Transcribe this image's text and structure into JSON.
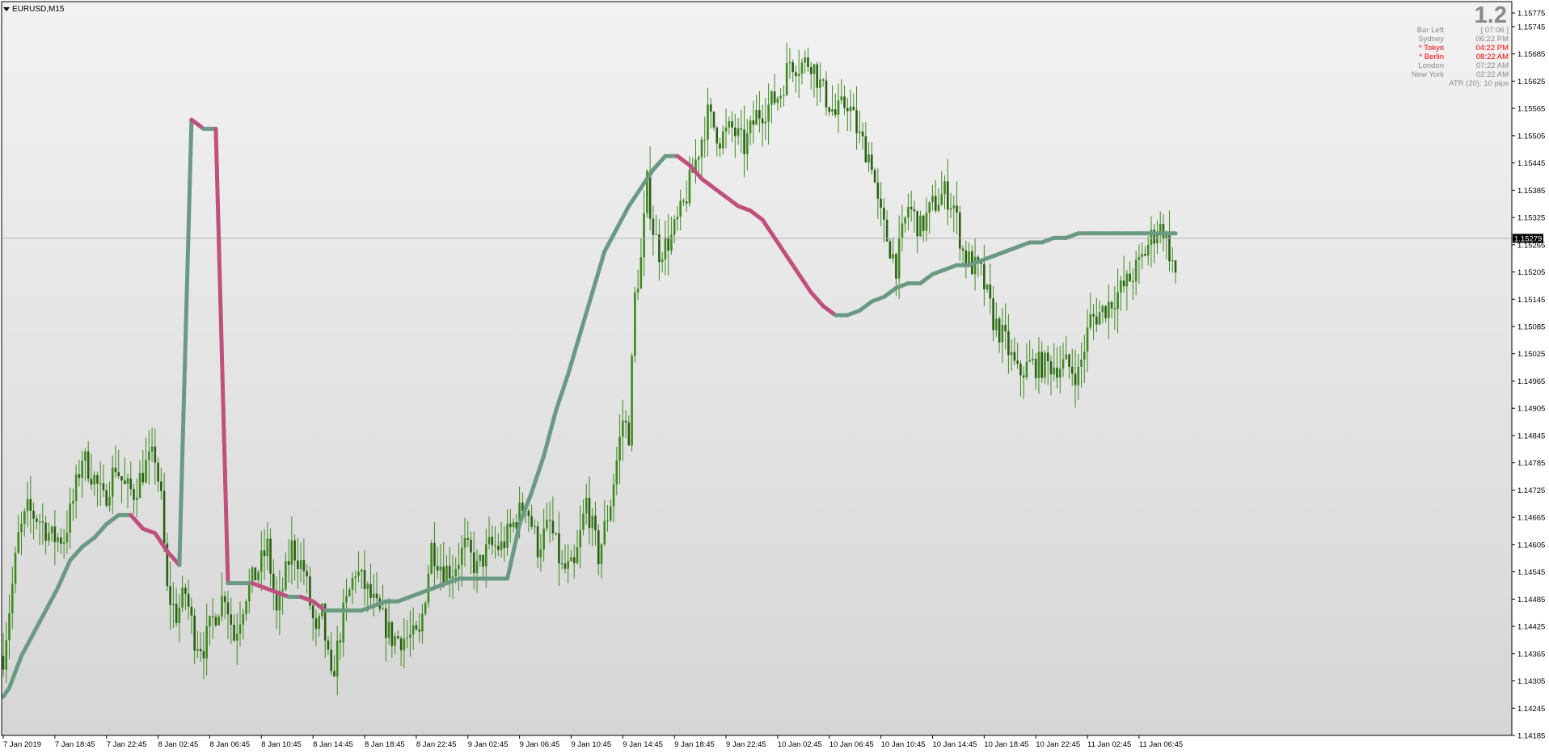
{
  "window": {
    "title": "EURUSD,M15",
    "current_price": "1.15279"
  },
  "info_panel": {
    "spread": "1.2",
    "rows": [
      {
        "label": "Bar Left",
        "value": "[ 07:06 ]",
        "active": false
      },
      {
        "label": "Sydney",
        "value": "06:22 PM",
        "active": false
      },
      {
        "label": "* Tokyo",
        "value": "04:22 PM",
        "active": true
      },
      {
        "label": "* Berlin",
        "value": "08:22 AM",
        "active": true
      },
      {
        "label": "London",
        "value": "07:22 AM",
        "active": false
      },
      {
        "label": "New York",
        "value": "02:22 AM",
        "active": false
      }
    ],
    "atr": "ATR (20): 10 pips"
  },
  "colors": {
    "background_top": "#f2f2f2",
    "background_bottom": "#d6d6d6",
    "candle": "#3d8a1e",
    "ma_up": "#6b9a82",
    "ma_down": "#c0507f",
    "price_line": "#b4b4b4"
  },
  "chart_data": {
    "type": "candlestick",
    "symbol": "EURUSD",
    "timeframe": "M15",
    "ylim": [
      1.14185,
      1.158
    ],
    "y_ticks": [
      "1.15775",
      "1.15745",
      "1.15685",
      "1.15625",
      "1.15565",
      "1.15505",
      "1.15445",
      "1.15385",
      "1.15325",
      "1.15265",
      "1.15205",
      "1.15145",
      "1.15085",
      "1.15025",
      "1.14965",
      "1.14905",
      "1.14845",
      "1.14785",
      "1.14725",
      "1.14665",
      "1.14605",
      "1.14545",
      "1.14485",
      "1.14425",
      "1.14365",
      "1.14305",
      "1.14245",
      "1.14185"
    ],
    "x_ticks": [
      "7 Jan 2019",
      "7 Jan 18:45",
      "7 Jan 22:45",
      "8 Jan 02:45",
      "8 Jan 06:45",
      "8 Jan 10:45",
      "8 Jan 14:45",
      "8 Jan 18:45",
      "8 Jan 22:45",
      "9 Jan 02:45",
      "9 Jan 06:45",
      "9 Jan 10:45",
      "9 Jan 14:45",
      "9 Jan 18:45",
      "9 Jan 22:45",
      "10 Jan 02:45",
      "10 Jan 06:45",
      "10 Jan 10:45",
      "10 Jan 14:45",
      "10 Jan 18:45",
      "10 Jan 22:45",
      "11 Jan 02:45",
      "11 Jan 06:45"
    ],
    "x_tick_bar_index": [
      0,
      17,
      34,
      51,
      68,
      85,
      102,
      119,
      136,
      153,
      170,
      187,
      204,
      221,
      238,
      255,
      272,
      289,
      306,
      323,
      340,
      357,
      374
    ],
    "current_price": 1.15279,
    "close_path_bars": [
      0,
      5,
      8,
      12,
      16,
      20,
      23,
      26,
      30,
      33,
      37,
      40,
      43,
      47,
      50,
      52,
      54,
      57,
      60,
      63,
      66,
      69,
      73,
      76,
      80,
      84,
      87,
      90,
      95,
      99,
      103,
      105,
      108,
      112,
      116,
      120,
      124,
      128,
      133,
      137,
      141,
      145,
      148,
      152,
      156,
      160,
      164,
      168,
      172,
      176,
      180,
      184,
      188,
      192,
      196,
      200,
      204,
      206,
      208,
      210,
      212,
      214,
      216,
      220,
      224,
      228,
      232,
      236,
      240,
      244,
      248,
      252,
      256,
      259,
      262,
      266,
      270,
      274,
      278,
      282,
      286,
      288,
      290,
      294,
      298,
      302,
      306,
      310,
      313,
      316,
      319,
      322,
      326,
      330,
      334,
      338,
      342,
      346,
      350,
      354,
      358,
      362,
      366,
      370,
      374,
      378,
      380,
      382,
      384,
      386
    ],
    "close_path_values": [
      1.1436,
      1.1462,
      1.1468,
      1.1466,
      1.1462,
      1.1462,
      1.147,
      1.148,
      1.1475,
      1.147,
      1.1478,
      1.1473,
      1.1472,
      1.1478,
      1.148,
      1.147,
      1.145,
      1.1445,
      1.145,
      1.144,
      1.1438,
      1.1444,
      1.145,
      1.144,
      1.145,
      1.1455,
      1.146,
      1.1445,
      1.146,
      1.1455,
      1.144,
      1.1445,
      1.143,
      1.1445,
      1.1455,
      1.145,
      1.1445,
      1.144,
      1.144,
      1.144,
      1.146,
      1.1455,
      1.1455,
      1.146,
      1.1455,
      1.146,
      1.146,
      1.1465,
      1.147,
      1.146,
      1.1465,
      1.1455,
      1.1455,
      1.147,
      1.1458,
      1.147,
      1.1488,
      1.1485,
      1.1515,
      1.1523,
      1.154,
      1.153,
      1.1525,
      1.1528,
      1.1535,
      1.1545,
      1.1555,
      1.155,
      1.1552,
      1.1548,
      1.1555,
      1.1557,
      1.156,
      1.1567,
      1.1566,
      1.1567,
      1.156,
      1.1555,
      1.1558,
      1.155,
      1.1545,
      1.1535,
      1.153,
      1.1522,
      1.1535,
      1.153,
      1.1535,
      1.1538,
      1.1535,
      1.1525,
      1.1522,
      1.152,
      1.151,
      1.1505,
      1.1498,
      1.15,
      1.15,
      1.15,
      1.15,
      1.1498,
      1.151,
      1.1512,
      1.1515,
      1.1518,
      1.1522,
      1.1528,
      1.153,
      1.153,
      1.1525,
      1.152,
      1.1522,
      1.1528,
      1.1528
    ],
    "moving_average": {
      "x": [
        0,
        2,
        6,
        10,
        14,
        18,
        22,
        26,
        30,
        34,
        38,
        42,
        46,
        50,
        54,
        58,
        62,
        66,
        70,
        74,
        78,
        82,
        86,
        90,
        94,
        98,
        102,
        106,
        110,
        114,
        118,
        122,
        126,
        130,
        134,
        138,
        142,
        146,
        150,
        154,
        158,
        162,
        166,
        170,
        174,
        178,
        182,
        186,
        190,
        194,
        198,
        202,
        206,
        210,
        214,
        218,
        222,
        226,
        230,
        234,
        238,
        242,
        246,
        250,
        254,
        258,
        262,
        266,
        270,
        274,
        278,
        282,
        286,
        290,
        294,
        298,
        302,
        306,
        310,
        314,
        318,
        322,
        326,
        330,
        334,
        338,
        342,
        346,
        350,
        354,
        358,
        362,
        366,
        370,
        374,
        378,
        382,
        386
      ],
      "values": [
        1.1427,
        1.1429,
        1.1436,
        1.1441,
        1.1446,
        1.1451,
        1.1457,
        1.146,
        1.1462,
        1.1465,
        1.1467,
        1.1467,
        1.1464,
        1.1463,
        1.1459,
        1.1456,
        1.1554,
        1.1552,
        1.1552,
        1.1452,
        1.1452,
        1.1452,
        1.1451,
        1.145,
        1.1449,
        1.1449,
        1.1448,
        1.1446,
        1.1446,
        1.1446,
        1.1446,
        1.1447,
        1.1448,
        1.1448,
        1.1449,
        1.145,
        1.1451,
        1.1452,
        1.1453,
        1.1453,
        1.1453,
        1.1453,
        1.1453,
        1.1465,
        1.1472,
        1.148,
        1.149,
        1.1498,
        1.1507,
        1.1516,
        1.1525,
        1.153,
        1.1535,
        1.1539,
        1.1543,
        1.1546,
        1.1546,
        1.1544,
        1.1541,
        1.1539,
        1.1537,
        1.1535,
        1.1534,
        1.1532,
        1.1528,
        1.1524,
        1.152,
        1.1516,
        1.1513,
        1.1511,
        1.1511,
        1.1512,
        1.1514,
        1.1515,
        1.1517,
        1.1518,
        1.1518,
        1.152,
        1.1521,
        1.1522,
        1.1522,
        1.1523,
        1.1524,
        1.1525,
        1.1526,
        1.1527,
        1.1527,
        1.1528,
        1.1528,
        1.1529,
        1.1529,
        1.1529,
        1.1529,
        1.1529,
        1.1529,
        1.1529,
        1.1529,
        1.1529
      ]
    }
  }
}
